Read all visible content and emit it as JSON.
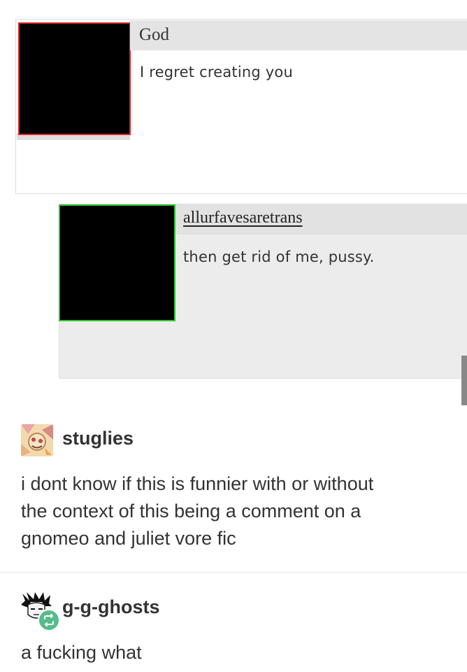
{
  "embedded_comments": {
    "parent": {
      "author": "God",
      "text": "I regret creating you"
    },
    "reply": {
      "author": "allurfavesaretrans",
      "text": "then get rid of me, pussy."
    }
  },
  "posts": [
    {
      "username": "stuglies",
      "body_lines": [
        "i dont know if this is funnier with or without",
        "the context of this being a comment on a",
        "gnomeo and juliet vore fic"
      ]
    },
    {
      "username": "g-g-ghosts",
      "body": "a fucking what",
      "badge": "reblog-icon"
    }
  ],
  "colors": {
    "god_avatar_border": "#d8242a",
    "reply_avatar_border": "#2cc52c",
    "reblog_badge": "#56bc8a"
  }
}
